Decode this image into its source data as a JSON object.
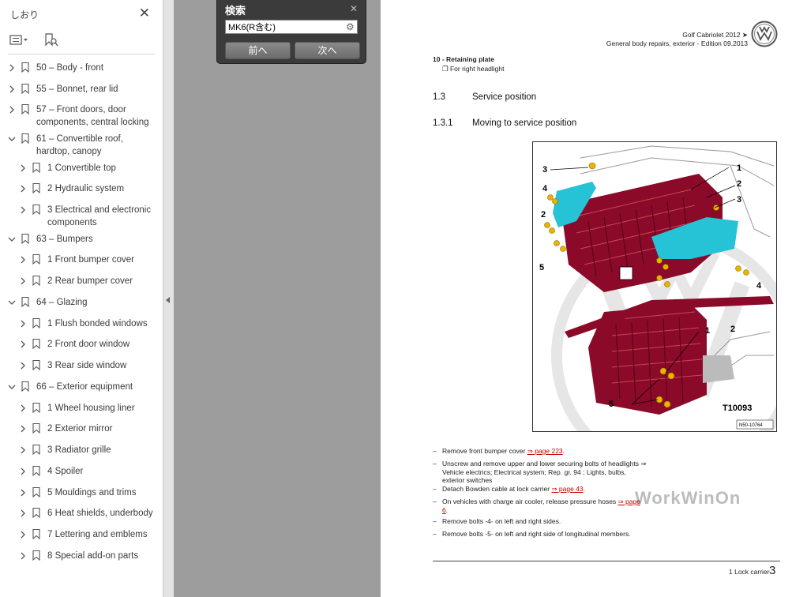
{
  "sidebar": {
    "title": "しおり",
    "close_icon": "close-icon",
    "options_icon": "list-options-icon",
    "find_bookmark_icon": "bookmark-search-icon",
    "items": [
      {
        "label": "50 – Body - front",
        "level": 0,
        "expanded": false
      },
      {
        "label": "55 – Bonnet, rear lid",
        "level": 0,
        "expanded": false
      },
      {
        "label": "57 – Front doors, door components, central locking",
        "level": 0,
        "expanded": false
      },
      {
        "label": "61 – Convertible roof, hardtop, canopy",
        "level": 0,
        "expanded": true
      },
      {
        "label": "1 Convertible top",
        "level": 1,
        "expanded": false
      },
      {
        "label": "2 Hydraulic system",
        "level": 1,
        "expanded": false
      },
      {
        "label": "3 Electrical and electronic components",
        "level": 1,
        "expanded": false
      },
      {
        "label": "63 – Bumpers",
        "level": 0,
        "expanded": true
      },
      {
        "label": "1 Front bumper cover",
        "level": 1,
        "expanded": false
      },
      {
        "label": "2 Rear bumper cover",
        "level": 1,
        "expanded": false
      },
      {
        "label": "64 – Glazing",
        "level": 0,
        "expanded": true
      },
      {
        "label": "1 Flush bonded windows",
        "level": 1,
        "expanded": false
      },
      {
        "label": "2 Front door window",
        "level": 1,
        "expanded": false
      },
      {
        "label": "3 Rear side window",
        "level": 1,
        "expanded": false
      },
      {
        "label": "66 – Exterior equipment",
        "level": 0,
        "expanded": true
      },
      {
        "label": "1 Wheel housing liner",
        "level": 1,
        "expanded": false
      },
      {
        "label": "2 Exterior mirror",
        "level": 1,
        "expanded": false
      },
      {
        "label": "3 Radiator grille",
        "level": 1,
        "expanded": false
      },
      {
        "label": "4 Spoiler",
        "level": 1,
        "expanded": false
      },
      {
        "label": "5 Mouldings and trims",
        "level": 1,
        "expanded": false
      },
      {
        "label": "6 Heat shields, underbody",
        "level": 1,
        "expanded": false
      },
      {
        "label": "7 Lettering and emblems",
        "level": 1,
        "expanded": false
      },
      {
        "label": "8 Special add-on parts",
        "level": 1,
        "expanded": false
      }
    ]
  },
  "search": {
    "title": "検索",
    "value": "MK6(R含む)",
    "prev_label": "前へ",
    "next_label": "次へ"
  },
  "document": {
    "header_line1": "Golf Cabriolet 2012 ➤",
    "header_line2": "General body repairs, exterior - Edition 09.2013",
    "item10_title": "10 - Retaining plate",
    "item10_sub": "For right headlight",
    "sec_num": "1.3",
    "sec_title": "Service position",
    "subsec_num": "1.3.1",
    "subsec_title": "Moving to service position",
    "figure": {
      "callouts_top": [
        "3",
        "4",
        "2",
        "5",
        "1",
        "2",
        "3",
        "5",
        "4"
      ],
      "callouts_bottom": [
        "1",
        "2",
        "5"
      ],
      "tool_label": "T10093",
      "image_id": "N50-10764",
      "watermark": "WorkWinOn"
    },
    "steps": [
      {
        "text": "Remove front bumper cover ",
        "link": "⇒ page 223",
        "after": "."
      },
      {
        "text": "Unscrew and remove upper and lower securing bolts of headlights ⇒ Vehicle electrics; Electrical system; Rep. gr. 94 ; Lights, bulbs, exterior switches",
        "link": "",
        "after": ""
      },
      {
        "text": "Detach Bowden cable at lock carrier ",
        "link": "⇒ page 43",
        "after": "."
      },
      {
        "text": "On vehicles with charge air cooler, release pressure hoses ",
        "link": "⇒ page 6",
        "after": "."
      },
      {
        "text": "Remove bolts -4- on left and right sides.",
        "link": "",
        "after": ""
      },
      {
        "text": "Remove bolts -5- on left and right side of longitudinal members.",
        "link": "",
        "after": ""
      }
    ],
    "footer_text": "1 Lock carrier",
    "page_number": "3"
  },
  "colors": {
    "accent_part": "#8b0a2a",
    "headlight": "#26c3d6",
    "bolt": "#e9b300",
    "link": "#c00000"
  }
}
